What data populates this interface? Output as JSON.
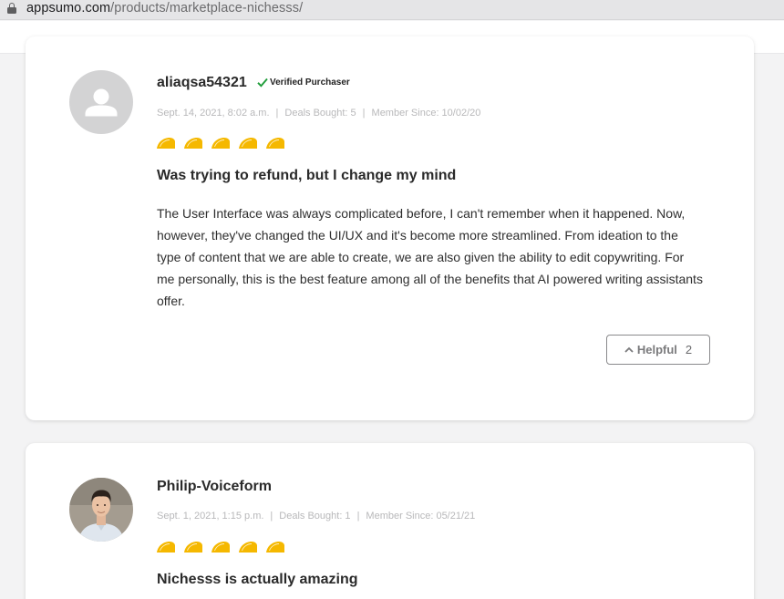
{
  "browser": {
    "url_domain": "appsumo.com",
    "url_path": "/products/marketplace-nichesss/"
  },
  "reviews": [
    {
      "username": "aliaqsa54321",
      "verified_label": "Verified Purchaser",
      "date": "Sept. 14, 2021, 8:02 a.m.",
      "deals_bought": "Deals Bought: 5",
      "member_since": "Member Since: 10/02/20",
      "rating": 5,
      "title": "Was trying to refund, but I change my mind",
      "body": "The User Interface was always complicated before, I can't remember when it happened. Now, however, they've changed the UI/UX and it's become more streamlined. From ideation to the type of content that we are able to create, we are also given the ability to edit copywriting. For me personally, this is the best feature among all of the benefits that AI powered writing assistants offer.",
      "helpful_label": "Helpful",
      "helpful_count": "2"
    },
    {
      "username": "Philip-Voiceform",
      "date": "Sept. 1, 2021, 1:15 p.m.",
      "deals_bought": "Deals Bought: 1",
      "member_since": "Member Since: 05/21/21",
      "rating": 5,
      "title": "Nichesss is actually amazing"
    }
  ],
  "icons": {
    "lock": "lock-icon",
    "check": "checkmark-icon",
    "taco": "taco-rating-icon",
    "chevron": "chevron-up-icon"
  },
  "colors": {
    "taco": "#f5b800",
    "check": "#1f9d3a",
    "avatar_placeholder": "#d3d3d4"
  }
}
